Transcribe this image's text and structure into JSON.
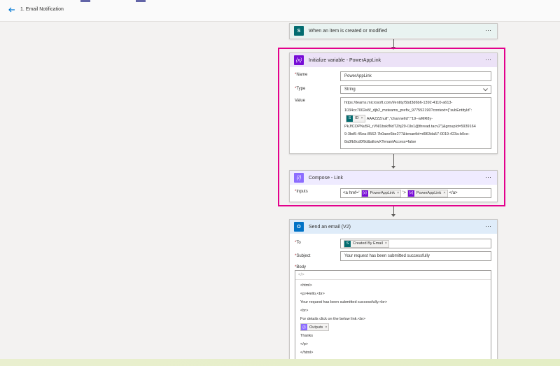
{
  "header": {
    "title": "1. Email Notification"
  },
  "trigger": {
    "label": "When an item is created or modified",
    "icon": "sharepoint-icon",
    "color": "#036c70"
  },
  "init_var": {
    "label": "Initialize variable - PowerAppLink",
    "name_label": "Name",
    "name_value": "PowerAppLink",
    "type_label": "Type",
    "type_value": "String",
    "value_label": "Value",
    "value_line1": "https://teams.microsoft.com/l/entity/5bd3d6b6-1392-4110-a613-",
    "value_line2": "1034cc7002e8/_djb2_msteams_prefix_977552190?context={\"subEntityId\":",
    "value_token": "ID",
    "value_line3": "AAAZZZnull\",\"channelId\":\"19--wMR8y-",
    "value_line4": "PkJfCOPNu5R_rVNl1bskfNdTZhj29-l1lo1@thread.tacv2\"}&groupId=5939164",
    "value_line5": "9-3bd5-45ea-8562-7b0aee6be277&tenantId=d963da57-0019-423a-b0ce-",
    "value_line6": "8a3fb9cd0f9d&allowXTenantAccess=false",
    "color": "#770bd6"
  },
  "compose": {
    "label": "Compose - Link",
    "inputs_label": "Inputs",
    "prefix": "<a href='",
    "token1": "PowerAppLink",
    "mid": "'>",
    "token2": "PowerAppLink",
    "suffix": "</a>",
    "color": "#8c6cff"
  },
  "email": {
    "label": "Send an email (V2)",
    "to_label": "To",
    "to_token": "Created By Email",
    "subject_label": "Subject",
    "subject_value": "Your request has been submitted successfully",
    "body_label": "Body",
    "body_lines": [
      "<html>",
      "<p>Hello,<br>",
      "Your request has been submitted successfully.<br>",
      "<br>",
      "For details click on the below link.<br>",
      "",
      "Thanks",
      "</p>",
      "</html>"
    ],
    "outputs_token": "Outputs",
    "color": "#0078d4"
  },
  "more_label": "···"
}
